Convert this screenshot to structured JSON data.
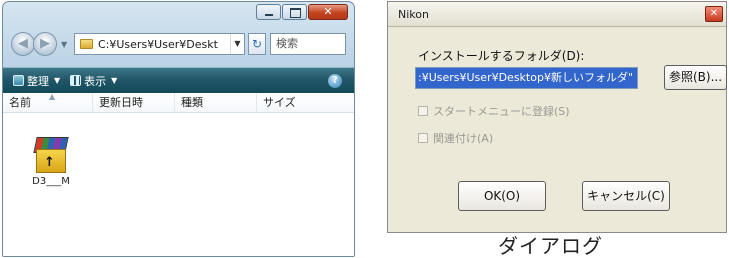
{
  "explorer": {
    "address_path": "C:¥Users¥User¥Deskt",
    "search_placeholder": "検索",
    "toolbar": {
      "organize_label": "整理",
      "view_label": "表示"
    },
    "columns": [
      "名前",
      "更新日時",
      "種類",
      "サイズ"
    ],
    "files": [
      {
        "name": "D3___M",
        "icon": "winrar-archive-icon"
      }
    ]
  },
  "dialog": {
    "title": "Nikon",
    "folder_label": "インストールするフォルダ(D):",
    "folder_value": ":¥Users¥User¥Desktop¥新しいフォルダ\"",
    "browse_label": "参照(B)...",
    "checkbox_start_menu": "スタートメニューに登録(S)",
    "checkbox_associate": "関連付け(A)",
    "ok_label": "OK(O)",
    "cancel_label": "キャンセル(C)"
  },
  "caption": "ダイアログ"
}
